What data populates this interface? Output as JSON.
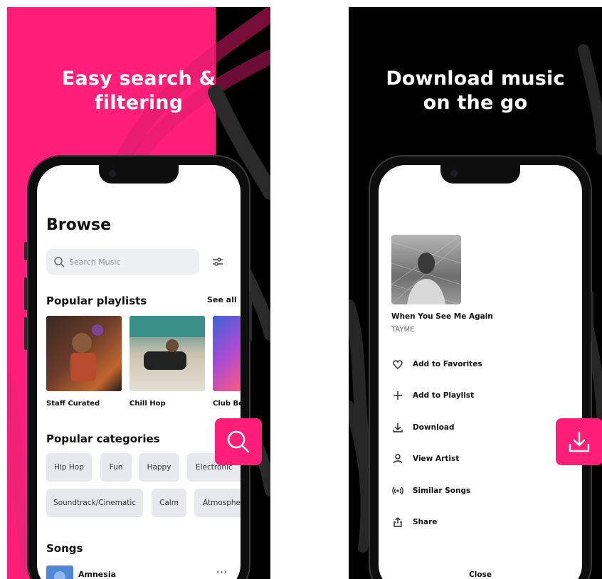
{
  "left_panel": {
    "headline": [
      "Easy search &",
      "filtering"
    ],
    "accent_color": "#ff1f78",
    "browse": {
      "title": "Browse",
      "search_placeholder": "Search Music",
      "popular_playlists": {
        "title": "Popular playlists",
        "see_all": "See all",
        "items": [
          {
            "label": "Staff Curated"
          },
          {
            "label": "Chill Hop"
          },
          {
            "label": "Club Be"
          }
        ]
      },
      "popular_categories": {
        "title": "Popular categories",
        "row1": [
          "Hip Hop",
          "Fun",
          "Happy",
          "Electronic"
        ],
        "row2": [
          "Soundtrack/Cinematic",
          "Calm",
          "Atmosphe"
        ]
      },
      "songs": {
        "title": "Songs",
        "items": [
          {
            "title": "Amnesia",
            "more": "···"
          }
        ]
      }
    },
    "fab_icon": "search-icon"
  },
  "right_panel": {
    "headline": [
      "Download music",
      "on the go"
    ],
    "track": {
      "title": "When You See Me Again",
      "artist": "TAYME"
    },
    "menu": [
      {
        "icon": "heart-icon",
        "label": "Add to Favorites"
      },
      {
        "icon": "plus-icon",
        "label": "Add to Playlist"
      },
      {
        "icon": "download-icon",
        "label": "Download"
      },
      {
        "icon": "person-icon",
        "label": "View Artist"
      },
      {
        "icon": "radio-icon",
        "label": "Similar Songs"
      },
      {
        "icon": "share-icon",
        "label": "Share"
      }
    ],
    "close_label": "Close",
    "fab_icon": "download-icon"
  }
}
